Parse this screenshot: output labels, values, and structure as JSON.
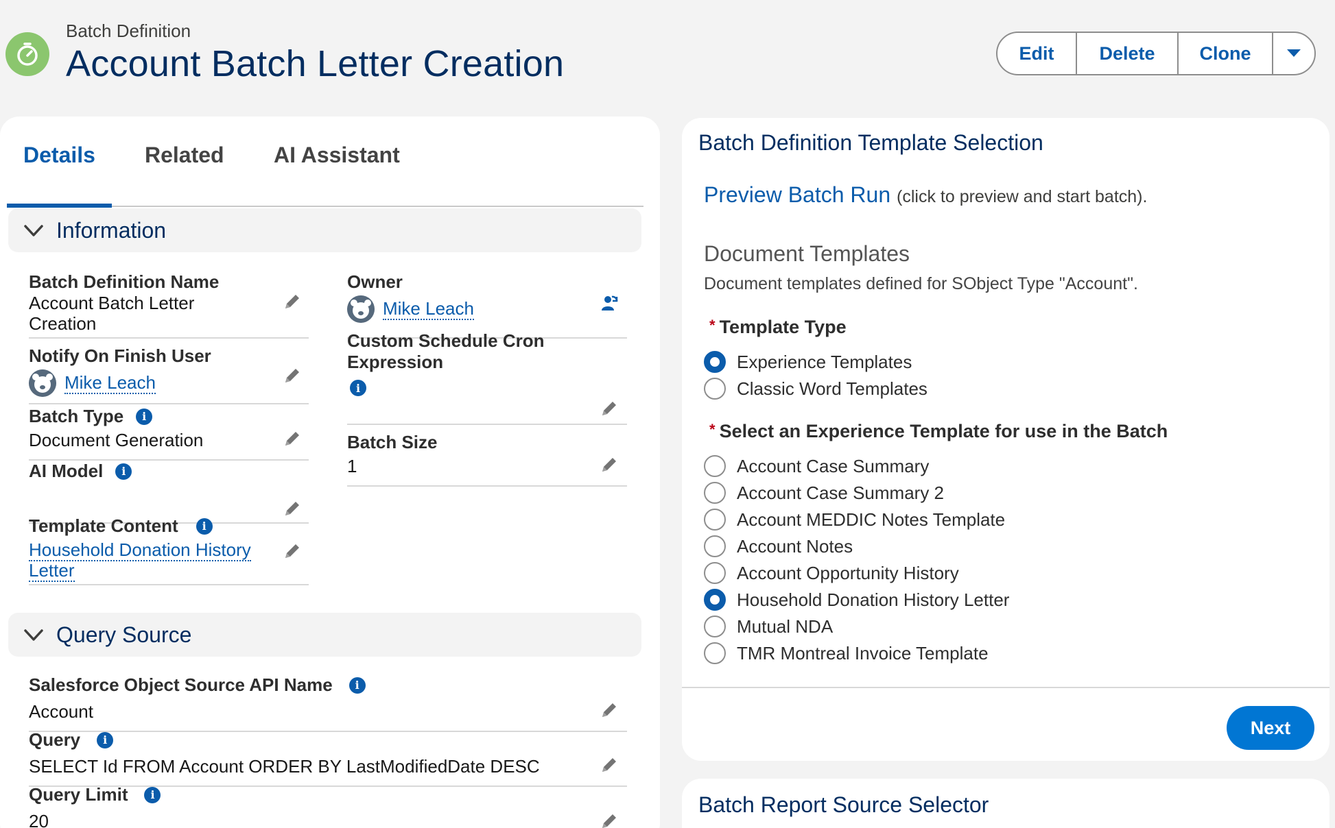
{
  "header": {
    "object_type": "Batch Definition",
    "title": "Account Batch Letter Creation",
    "actions": {
      "edit": "Edit",
      "delete": "Delete",
      "clone": "Clone"
    },
    "icon": "stopwatch-icon",
    "icon_color": "#8bc66e"
  },
  "tabs": [
    {
      "label": "Details",
      "active": true
    },
    {
      "label": "Related",
      "active": false
    },
    {
      "label": "AI Assistant",
      "active": false
    }
  ],
  "information": {
    "section_title": "Information",
    "batch_definition_name": {
      "label": "Batch Definition Name",
      "value_line1": "Account Batch Letter",
      "value_line2": "Creation"
    },
    "owner": {
      "label": "Owner",
      "value": "Mike Leach"
    },
    "notify_on_finish_user": {
      "label": "Notify On Finish User",
      "value": "Mike Leach"
    },
    "custom_schedule_cron": {
      "label_line1": "Custom Schedule Cron",
      "label_line2": "Expression",
      "value": ""
    },
    "batch_type": {
      "label": "Batch Type",
      "value": "Document Generation"
    },
    "batch_size": {
      "label": "Batch Size",
      "value": "1"
    },
    "ai_model": {
      "label": "AI Model",
      "value": ""
    },
    "template_content": {
      "label": "Template Content",
      "value_line1": "Household Donation History",
      "value_line2": "Letter"
    }
  },
  "query_source": {
    "section_title": "Query Source",
    "object_api_name": {
      "label": "Salesforce Object Source API Name",
      "value": "Account"
    },
    "query": {
      "label": "Query",
      "value": "SELECT Id FROM Account ORDER BY LastModifiedDate DESC"
    },
    "query_limit": {
      "label": "Query Limit",
      "value": "20"
    }
  },
  "template_selection": {
    "title": "Batch Definition Template Selection",
    "preview_link": "Preview Batch Run",
    "preview_note": "(click to preview and start batch).",
    "doc_header": "Document Templates",
    "doc_desc": "Document templates defined for SObject Type \"Account\".",
    "template_type_label": "Template Type",
    "template_types": [
      {
        "label": "Experience Templates",
        "checked": true
      },
      {
        "label": "Classic Word Templates",
        "checked": false
      }
    ],
    "experience_label": "Select an Experience Template for use in the Batch",
    "experience_templates": [
      {
        "label": "Account Case Summary",
        "checked": false
      },
      {
        "label": "Account Case Summary 2",
        "checked": false
      },
      {
        "label": "Account MEDDIC Notes Template",
        "checked": false
      },
      {
        "label": "Account Notes",
        "checked": false
      },
      {
        "label": "Account Opportunity History",
        "checked": false
      },
      {
        "label": "Household Donation History Letter",
        "checked": true
      },
      {
        "label": "Mutual NDA",
        "checked": false
      },
      {
        "label": "TMR Montreal Invoice Template",
        "checked": false
      }
    ],
    "next_label": "Next",
    "required_star": "*"
  },
  "report_selector": {
    "title": "Batch Report Source Selector"
  },
  "colors": {
    "brand": "#0b5cab",
    "title": "#032d60",
    "button": "#0176d3",
    "required": "#ba0517"
  }
}
